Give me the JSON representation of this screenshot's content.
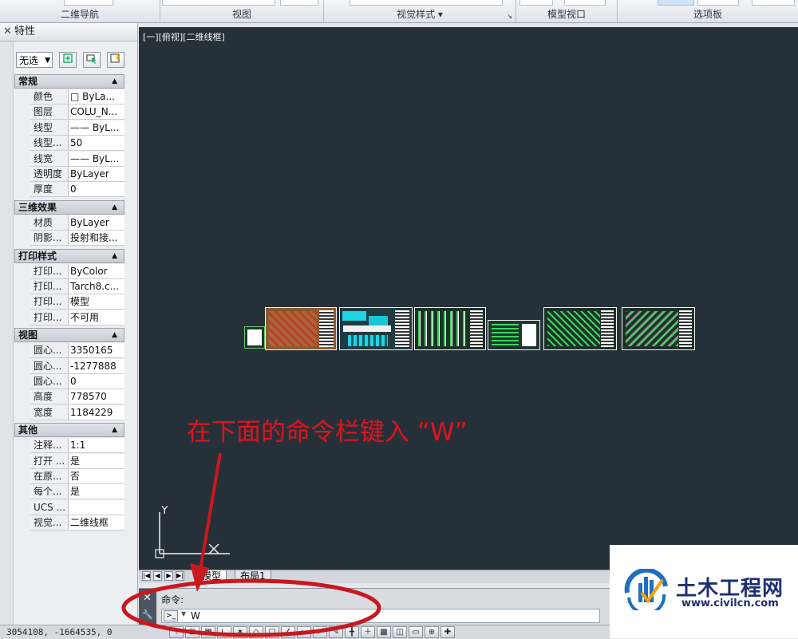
{
  "ribbon": {
    "sections": [
      "二维导航",
      "视图",
      "视觉样式",
      "模型视口",
      "选项板"
    ],
    "visual_style_dropdown": "视觉样式 ▾",
    "corner_icon": "↘"
  },
  "palette": {
    "title": "特性",
    "title_icon": "close-icon",
    "selection": "无选",
    "categories": [
      {
        "label": "常规",
        "rows": [
          {
            "name": "颜色",
            "value": "□ ByLa..."
          },
          {
            "name": "图层",
            "value": "COLU_N..."
          },
          {
            "name": "线型",
            "value": "—— ByL..."
          },
          {
            "name": "线型...",
            "value": "50"
          },
          {
            "name": "线宽",
            "value": "—— ByL..."
          },
          {
            "name": "透明度",
            "value": "ByLayer"
          },
          {
            "name": "厚度",
            "value": "0"
          }
        ]
      },
      {
        "label": "三维效果",
        "rows": [
          {
            "name": "材质",
            "value": "ByLayer"
          },
          {
            "name": "阴影...",
            "value": "投射和接..."
          }
        ]
      },
      {
        "label": "打印样式",
        "rows": [
          {
            "name": "打印...",
            "value": "ByColor"
          },
          {
            "name": "打印...",
            "value": "Tarch8.c..."
          },
          {
            "name": "打印...",
            "value": "模型"
          },
          {
            "name": "打印...",
            "value": "不可用"
          }
        ]
      },
      {
        "label": "视图",
        "rows": [
          {
            "name": "圆心...",
            "value": "3350165"
          },
          {
            "name": "圆心...",
            "value": "-1277888"
          },
          {
            "name": "圆心...",
            "value": "0"
          },
          {
            "name": "高度",
            "value": "778570"
          },
          {
            "name": "宽度",
            "value": "1184229"
          }
        ]
      },
      {
        "label": "其他",
        "rows": [
          {
            "name": "注释...",
            "value": "1:1"
          },
          {
            "name": "打开 ...",
            "value": "是"
          },
          {
            "name": "在原...",
            "value": "否"
          },
          {
            "name": "每个...",
            "value": "是"
          },
          {
            "name": "UCS ...",
            "value": ""
          },
          {
            "name": "视觉...",
            "value": "二维线框"
          }
        ]
      }
    ]
  },
  "viewport": {
    "label": "[一][俯视][二维线框]",
    "annotation": "在下面的命令栏键入 “W”",
    "ucs_y": "Y",
    "colors": {
      "background": "#263039",
      "annotation": "#e0141e"
    }
  },
  "tabs": {
    "model": "模型",
    "layout": "布局1"
  },
  "command": {
    "history": "命令:",
    "input": "W"
  },
  "status": {
    "coords": "3054108, -1664535, 0"
  },
  "watermark": {
    "name": "土木工程网",
    "url": "www.civilcn.com"
  }
}
